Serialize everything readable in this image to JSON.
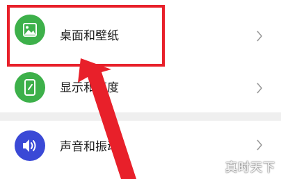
{
  "settings": {
    "items": [
      {
        "label": "桌面和壁纸",
        "icon": "image-icon",
        "icon_color": "#3db04a"
      },
      {
        "label": "显示和亮度",
        "icon": "phone-brightness-icon",
        "icon_color": "#3db04a"
      },
      {
        "label": "声音和振动",
        "icon": "speaker-icon",
        "icon_color": "#3a49d6"
      }
    ]
  },
  "annotation": {
    "box_color": "#e8202a",
    "arrow_color": "#e8202a"
  },
  "watermark": {
    "text": "真时天下"
  }
}
